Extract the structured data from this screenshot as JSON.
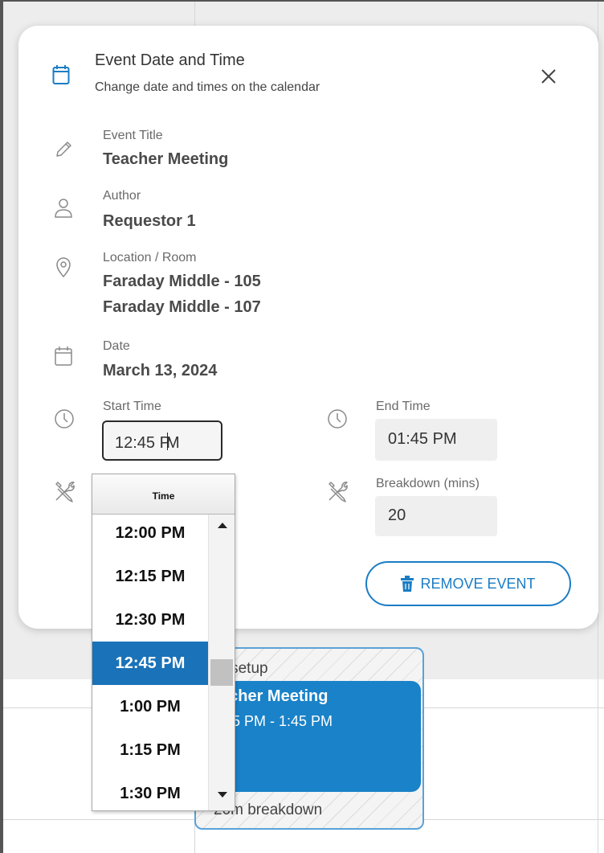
{
  "header": {
    "title": "Event Date and Time",
    "subtitle": "Change date and times on the calendar"
  },
  "fields": {
    "event_title": {
      "label": "Event Title",
      "value": "Teacher Meeting"
    },
    "author": {
      "label": "Author",
      "value": "Requestor 1"
    },
    "location": {
      "label": "Location / Room",
      "values": [
        "Faraday Middle - 105",
        "Faraday Middle - 107"
      ]
    },
    "date": {
      "label": "Date",
      "value": "March 13, 2024"
    },
    "start_time": {
      "label": "Start Time",
      "value_before_caret": "12:45 P",
      "value_after_caret": "M"
    },
    "end_time": {
      "label": "End Time",
      "value": "01:45 PM"
    },
    "breakdown": {
      "label": "Breakdown (mins)",
      "value": "20"
    }
  },
  "remove_button": {
    "label": "REMOVE EVENT"
  },
  "time_dropdown": {
    "header": "Time",
    "options": [
      "12:00 PM",
      "12:15 PM",
      "12:30 PM",
      "12:45 PM",
      "1:00 PM",
      "1:15 PM",
      "1:30 PM"
    ],
    "selected": "12:45 PM"
  },
  "background_event": {
    "setup_text": "m setup",
    "title": "acher Meeting",
    "time": ":45 PM - 1:45 PM",
    "breakdown_text": "20m breakdown"
  },
  "colors": {
    "accent": "#1a7dc4",
    "selected_option": "#1a72b8",
    "event_block": "#1a82c8"
  },
  "icons": [
    "calendar-icon",
    "close-icon",
    "pencil-icon",
    "user-icon",
    "location-pin-icon",
    "calendar-icon",
    "clock-icon",
    "tools-icon",
    "trash-icon"
  ]
}
